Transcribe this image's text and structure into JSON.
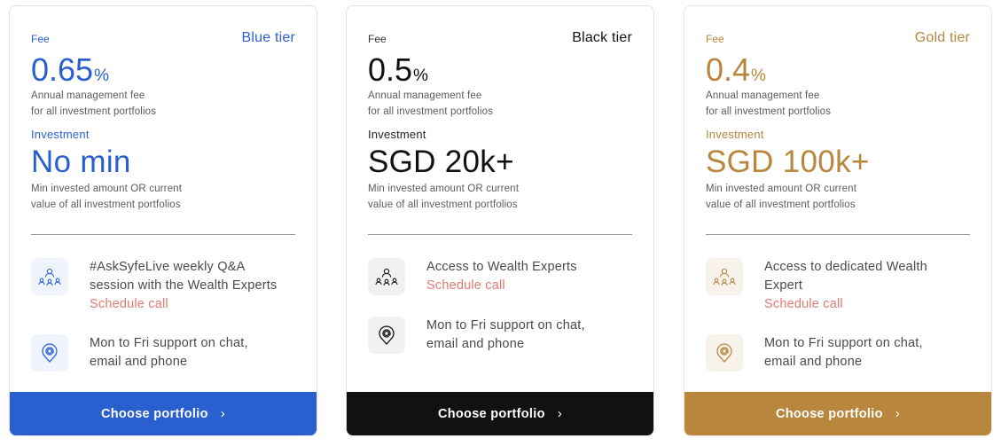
{
  "colors": {
    "blue": "#2a5fd0",
    "black": "#111111",
    "gold": "#b8863d",
    "link": "#e07a74"
  },
  "cards": [
    {
      "tier": "Blue tier",
      "fee_label": "Fee",
      "fee_value": "0.65",
      "fee_unit": "%",
      "fee_desc_1": "Annual management fee",
      "fee_desc_2": "for all investment portfolios",
      "investment_label": "Investment",
      "investment_value": "No min",
      "investment_desc_1": "Min invested amount OR current",
      "investment_desc_2": "value of all investment portfolios",
      "features": [
        {
          "icon": "people-network-icon",
          "lines": [
            "#AskSyfeLive weekly Q&A",
            "session with the Wealth Experts"
          ],
          "link": "Schedule call"
        },
        {
          "icon": "chat-at-icon",
          "lines": [
            "Mon to Fri support on chat,",
            "email and phone"
          ],
          "link": ""
        }
      ],
      "cta": "Choose portfolio"
    },
    {
      "tier": "Black tier",
      "fee_label": "Fee",
      "fee_value": "0.5",
      "fee_unit": "%",
      "fee_desc_1": "Annual management fee",
      "fee_desc_2": "for all investment portfolios",
      "investment_label": "Investment",
      "investment_value": "SGD 20k+",
      "investment_desc_1": "Min invested amount OR current",
      "investment_desc_2": "value of all investment portfolios",
      "features": [
        {
          "icon": "people-network-icon",
          "lines": [
            "Access to Wealth Experts"
          ],
          "link": "Schedule call"
        },
        {
          "icon": "chat-at-icon",
          "lines": [
            "Mon to Fri support on chat,",
            "email and phone"
          ],
          "link": ""
        }
      ],
      "cta": "Choose portfolio"
    },
    {
      "tier": "Gold tier",
      "fee_label": "Fee",
      "fee_value": "0.4",
      "fee_unit": "%",
      "fee_desc_1": "Annual management fee",
      "fee_desc_2": "for all investment portfolios",
      "investment_label": "Investment",
      "investment_value": "SGD 100k+",
      "investment_desc_1": "Min invested amount OR current",
      "investment_desc_2": "value of all investment portfolios",
      "features": [
        {
          "icon": "people-network-icon",
          "lines": [
            "Access to dedicated Wealth",
            "Expert"
          ],
          "link": "Schedule call"
        },
        {
          "icon": "chat-at-icon",
          "lines": [
            "Mon to Fri support on chat,",
            "email and phone"
          ],
          "link": ""
        }
      ],
      "cta": "Choose portfolio"
    }
  ]
}
